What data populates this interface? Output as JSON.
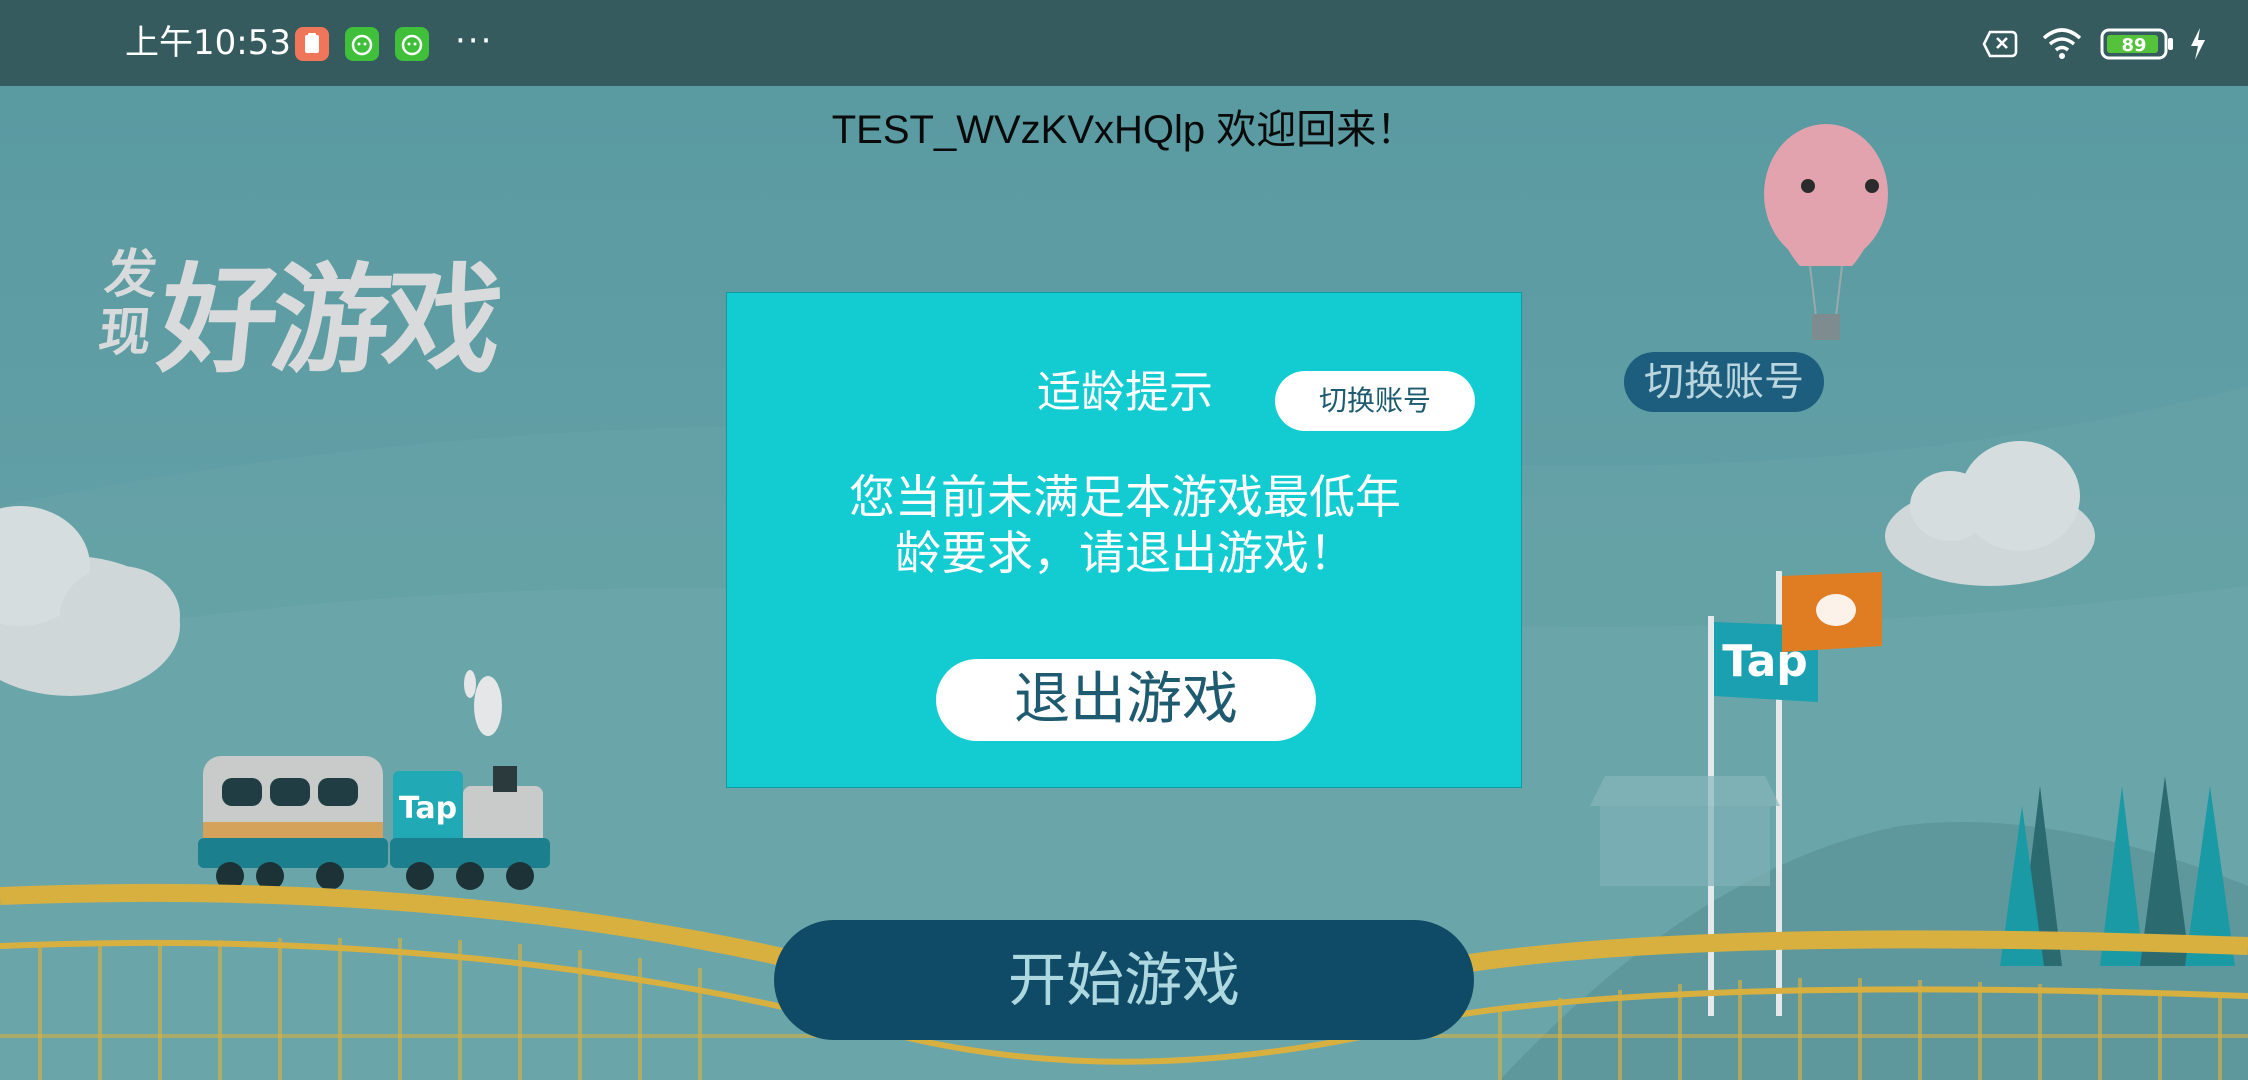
{
  "status_bar": {
    "time": "上午10:53",
    "more": "···",
    "battery_level": "89",
    "icons": [
      "clipboard-app-icon",
      "cat-app-icon",
      "cat-app-icon",
      "no-sim-icon",
      "wifi-icon",
      "battery-icon",
      "charging-icon"
    ]
  },
  "header": {
    "welcome": "TEST_WVzKVxHQlp 欢迎回来！"
  },
  "background": {
    "logo_small": "发现",
    "logo_large": "好游戏",
    "train_badge": "Tap",
    "flag_badge": "Tap",
    "switch_account_label": "切换账号"
  },
  "dialog": {
    "title": "适龄提示",
    "switch_account_label": "切换账号",
    "message_line1": "您当前未满足本游戏最低年",
    "message_line2": "龄要求，请退出游戏！",
    "exit_label": "退出游戏"
  },
  "start_button": {
    "label": "开始游戏"
  },
  "colors": {
    "dialog_bg": "#13ccd2",
    "start_button_bg": "#0f4b66",
    "status_bar_bg": "#355b5e",
    "flag_orange": "#e07d22"
  }
}
